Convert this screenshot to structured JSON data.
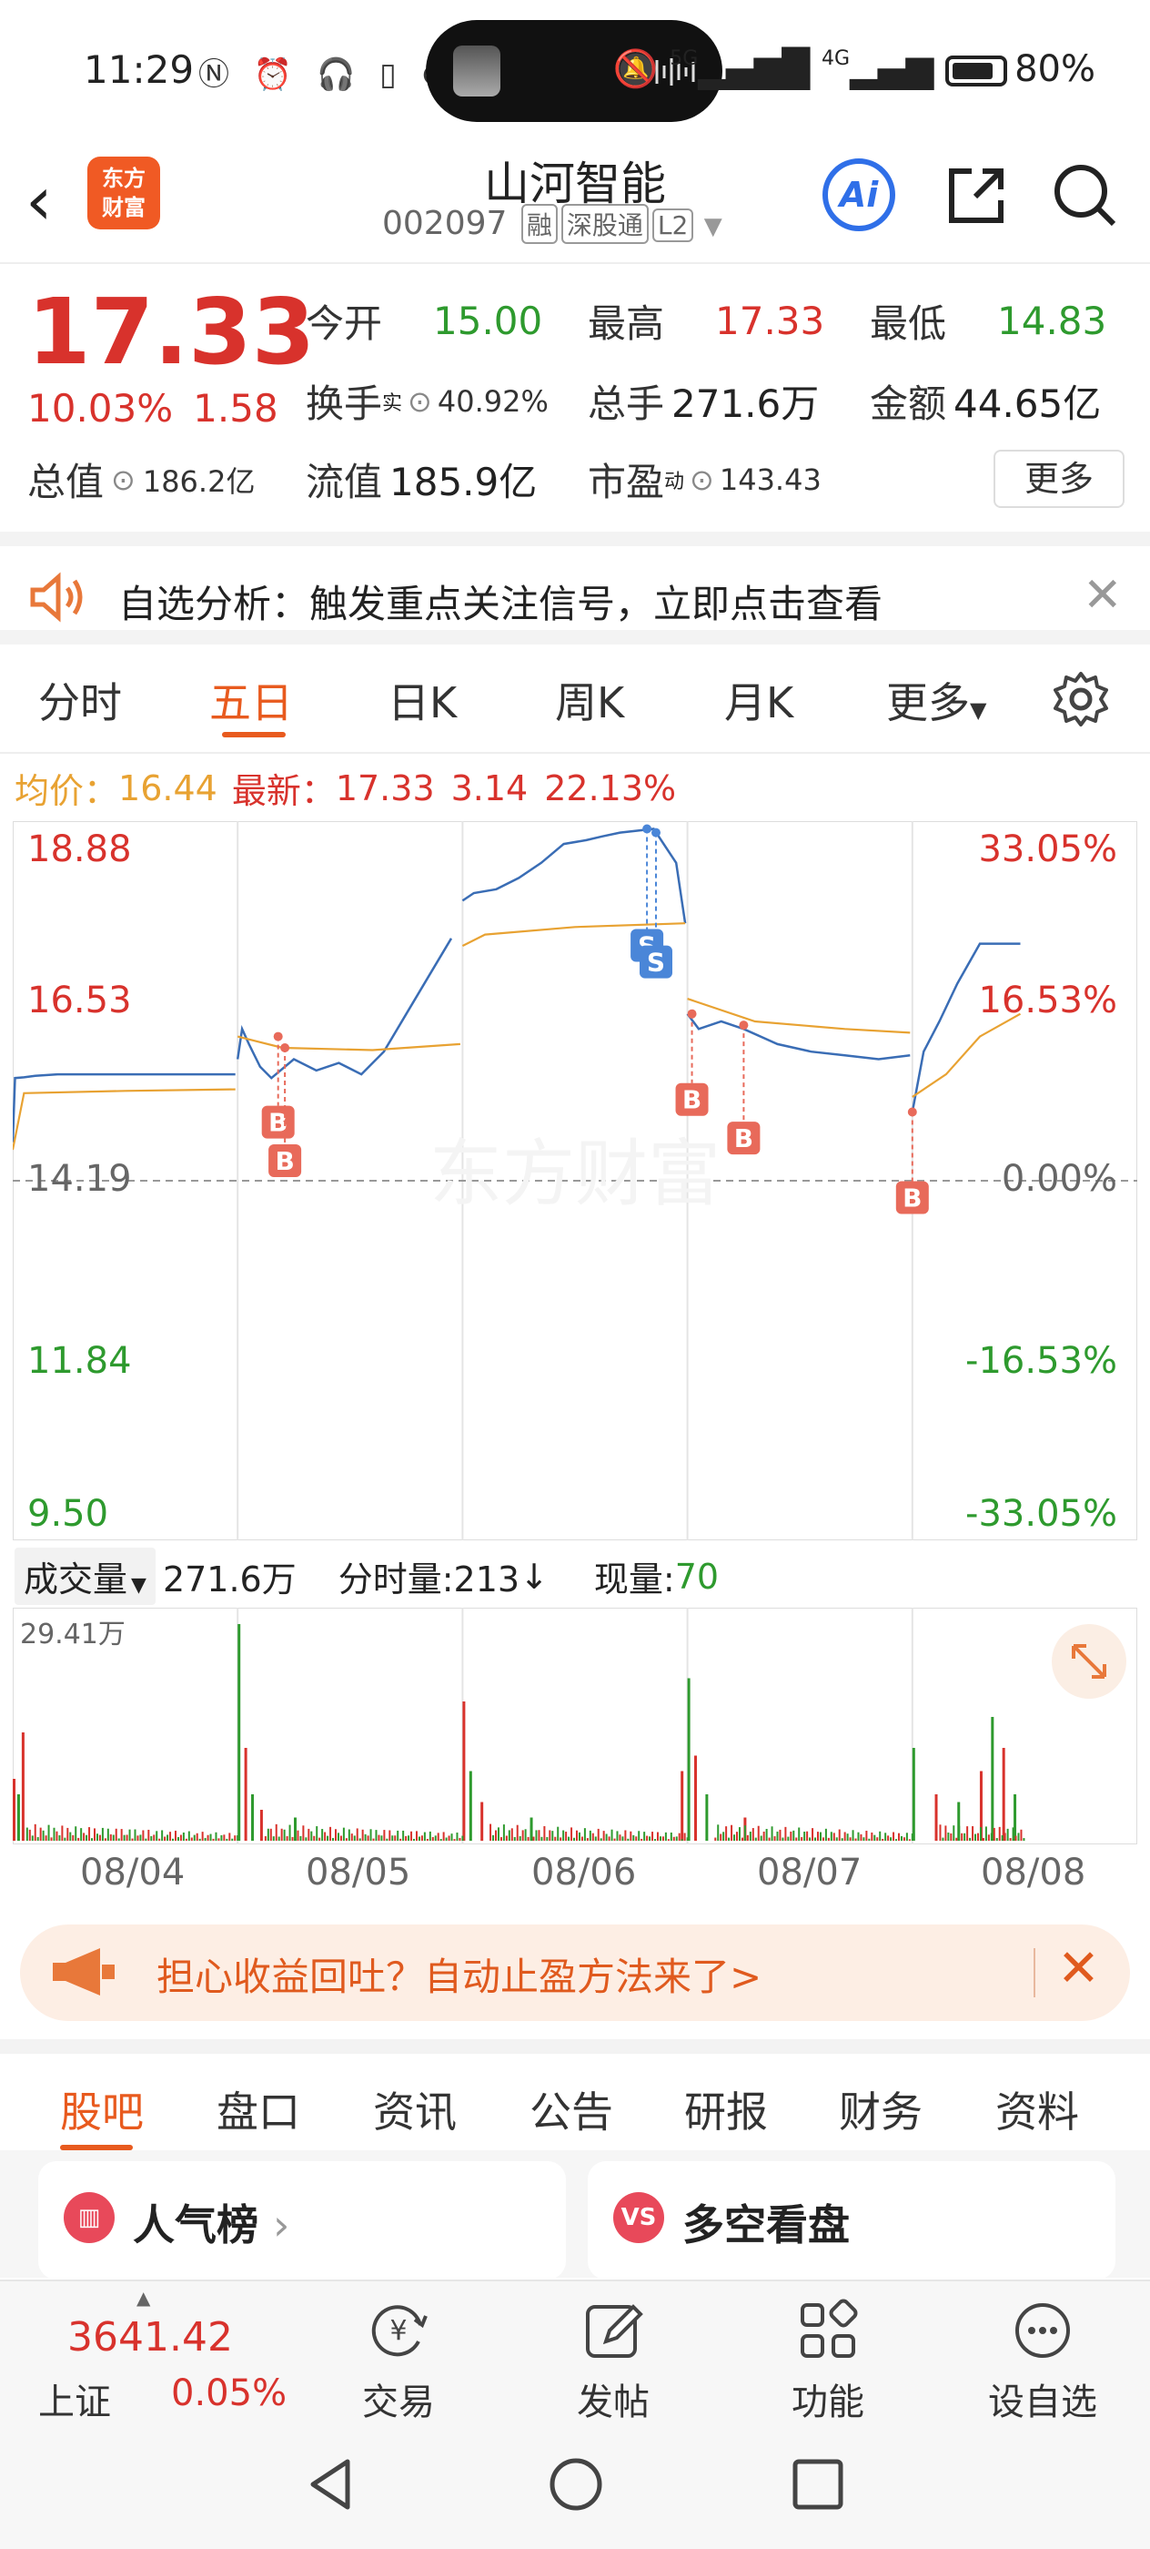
{
  "status": {
    "time": "11:29",
    "signal": "5G",
    "signal2": "4G",
    "battery": "80%"
  },
  "header": {
    "logo_line1": "东方",
    "logo_line2": "财富",
    "stock_name": "山河智能",
    "stock_code": "002097",
    "tags": [
      "融",
      "深股通",
      "L2"
    ],
    "ai_label": "Ai"
  },
  "quote": {
    "price": "17.33",
    "change_pct": "10.03%",
    "change": "1.58",
    "open_label": "今开",
    "open": "15.00",
    "high_label": "最高",
    "high": "17.33",
    "low_label": "最低",
    "low": "14.83",
    "turnover_label": "换手",
    "turnover_sup": "实",
    "turnover": "40.92%",
    "volume_label": "总手",
    "volume": "271.6万",
    "amount_label": "金额",
    "amount": "44.65亿",
    "mktcap_label": "总值",
    "mktcap": "186.2亿",
    "float_label": "流值",
    "float": "185.9亿",
    "pe_label": "市盈",
    "pe_sup": "动",
    "pe": "143.43",
    "more": "更多"
  },
  "signal_banner": {
    "text": "自选分析：触发重点关注信号，立即点击查看"
  },
  "chart_tabs": {
    "items": [
      "分时",
      "五日",
      "日K",
      "周K",
      "月K",
      "更多"
    ],
    "active": "五日"
  },
  "avg_row": {
    "avg_label": "均价：",
    "avg": "16.44",
    "latest_label": "最新：",
    "latest": "17.33",
    "chg": "3.14",
    "chg_pct": "22.13%"
  },
  "chart_data": {
    "type": "line",
    "title": "",
    "x_labels": [
      "08/04",
      "08/05",
      "08/06",
      "08/07",
      "08/08"
    ],
    "y_left_ticks": [
      "18.88",
      "16.53",
      "14.19",
      "11.84",
      "9.50"
    ],
    "y_right_ticks": [
      "33.05%",
      "16.53%",
      "0.00%",
      "-16.53%",
      "-33.05%"
    ],
    "ylim": [
      9.5,
      18.88
    ],
    "base_price": 14.19,
    "series": [
      {
        "name": "",
        "color": "#3a6db5",
        "values": [
          [
            0.0,
            14.7
          ],
          [
            0.01,
            15.55
          ],
          [
            0.05,
            15.56
          ],
          [
            0.1,
            15.58
          ],
          [
            0.2,
            15.6
          ],
          [
            0.4,
            15.6
          ],
          [
            0.6,
            15.6
          ],
          [
            0.8,
            15.6
          ],
          [
            0.99,
            15.6
          ],
          [
            1.0,
            15.8
          ],
          [
            1.02,
            16.2
          ],
          [
            1.05,
            16.0
          ],
          [
            1.1,
            15.7
          ],
          [
            1.15,
            15.55
          ],
          [
            1.25,
            15.8
          ],
          [
            1.35,
            15.65
          ],
          [
            1.45,
            15.75
          ],
          [
            1.55,
            15.6
          ],
          [
            1.65,
            15.9
          ],
          [
            1.75,
            16.4
          ],
          [
            1.85,
            16.9
          ],
          [
            1.95,
            17.4
          ],
          [
            2.0,
            17.9
          ],
          [
            2.05,
            18.0
          ],
          [
            2.15,
            18.05
          ],
          [
            2.25,
            18.2
          ],
          [
            2.35,
            18.4
          ],
          [
            2.45,
            18.65
          ],
          [
            2.55,
            18.7
          ],
          [
            2.62,
            18.75
          ],
          [
            2.7,
            18.8
          ],
          [
            2.85,
            18.85
          ],
          [
            2.95,
            18.4
          ],
          [
            2.99,
            17.6
          ],
          [
            3.0,
            16.4
          ],
          [
            3.05,
            16.2
          ],
          [
            3.15,
            16.3
          ],
          [
            3.25,
            16.2
          ],
          [
            3.4,
            16.0
          ],
          [
            3.55,
            15.9
          ],
          [
            3.7,
            15.85
          ],
          [
            3.85,
            15.8
          ],
          [
            3.99,
            15.85
          ],
          [
            4.0,
            15.1
          ],
          [
            4.05,
            15.9
          ],
          [
            4.12,
            16.3
          ],
          [
            4.2,
            16.8
          ],
          [
            4.3,
            17.33
          ],
          [
            4.48,
            17.33
          ]
        ]
      },
      {
        "name": "",
        "color": "#e8a232",
        "values": [
          [
            0.0,
            14.6
          ],
          [
            0.05,
            15.35
          ],
          [
            0.5,
            15.38
          ],
          [
            0.99,
            15.4
          ],
          [
            1.0,
            16.1
          ],
          [
            1.2,
            15.95
          ],
          [
            1.6,
            15.92
          ],
          [
            1.99,
            16.0
          ],
          [
            2.0,
            17.3
          ],
          [
            2.1,
            17.45
          ],
          [
            2.5,
            17.55
          ],
          [
            2.99,
            17.6
          ],
          [
            3.0,
            16.6
          ],
          [
            3.3,
            16.3
          ],
          [
            3.7,
            16.2
          ],
          [
            3.99,
            16.15
          ],
          [
            4.0,
            15.3
          ],
          [
            4.15,
            15.6
          ],
          [
            4.3,
            16.1
          ],
          [
            4.48,
            16.4
          ]
        ]
      }
    ],
    "markers": [
      {
        "label": "B",
        "day_x": 1.18,
        "price": 16.1
      },
      {
        "label": "B",
        "day_x": 1.21,
        "price": 15.95
      },
      {
        "label": "S",
        "day_x": 2.82,
        "price": 18.85
      },
      {
        "label": "S",
        "day_x": 2.86,
        "price": 18.8
      },
      {
        "label": "B",
        "day_x": 3.02,
        "price": 16.4
      },
      {
        "label": "B",
        "day_x": 3.25,
        "price": 16.25
      },
      {
        "label": "B",
        "day_x": 4.0,
        "price": 15.1
      }
    ]
  },
  "volume": {
    "selector": "成交量",
    "total": "271.6万",
    "tick_label": "分时量:213",
    "arrow": "↓",
    "now_label": "现量:",
    "now": "70",
    "max": "29.41万"
  },
  "volume_data": {
    "type": "bar",
    "ylim": [
      0,
      29.41
    ],
    "days": 5,
    "spikes": [
      [
        0.0,
        8
      ],
      [
        0.02,
        6
      ],
      [
        0.04,
        14
      ],
      [
        1.0,
        28
      ],
      [
        1.03,
        12
      ],
      [
        1.06,
        6
      ],
      [
        1.1,
        4
      ],
      [
        1.25,
        3
      ],
      [
        2.0,
        18
      ],
      [
        2.03,
        9
      ],
      [
        2.08,
        5
      ],
      [
        2.3,
        3
      ],
      [
        2.97,
        9
      ],
      [
        3.0,
        21
      ],
      [
        3.03,
        11
      ],
      [
        3.08,
        6
      ],
      [
        3.25,
        3
      ],
      [
        4.0,
        12
      ],
      [
        4.1,
        6
      ],
      [
        4.2,
        5
      ],
      [
        4.3,
        9
      ],
      [
        4.35,
        16
      ],
      [
        4.4,
        12
      ],
      [
        4.45,
        6
      ]
    ]
  },
  "promo": {
    "text": "担心收益回吐？自动止盈方法来了>"
  },
  "lower_tabs": {
    "items": [
      "股吧",
      "盘口",
      "资讯",
      "公告",
      "研报",
      "财务",
      "资料"
    ],
    "active": "股吧"
  },
  "cards": {
    "left_title": "人气榜",
    "left_arrow": "›",
    "right_icon": "VS",
    "right_title": "多空看盘"
  },
  "toolbar": {
    "index_value": "3641.42",
    "index_name": "上证",
    "index_pct": "0.05%",
    "items": [
      "交易",
      "发帖",
      "功能",
      "设自选"
    ]
  },
  "colors": {
    "rise": "#d8322c",
    "fall": "#2e9a2e",
    "accent": "#e85a1e",
    "avg_line": "#e8a232",
    "price_line": "#3a6db5"
  }
}
